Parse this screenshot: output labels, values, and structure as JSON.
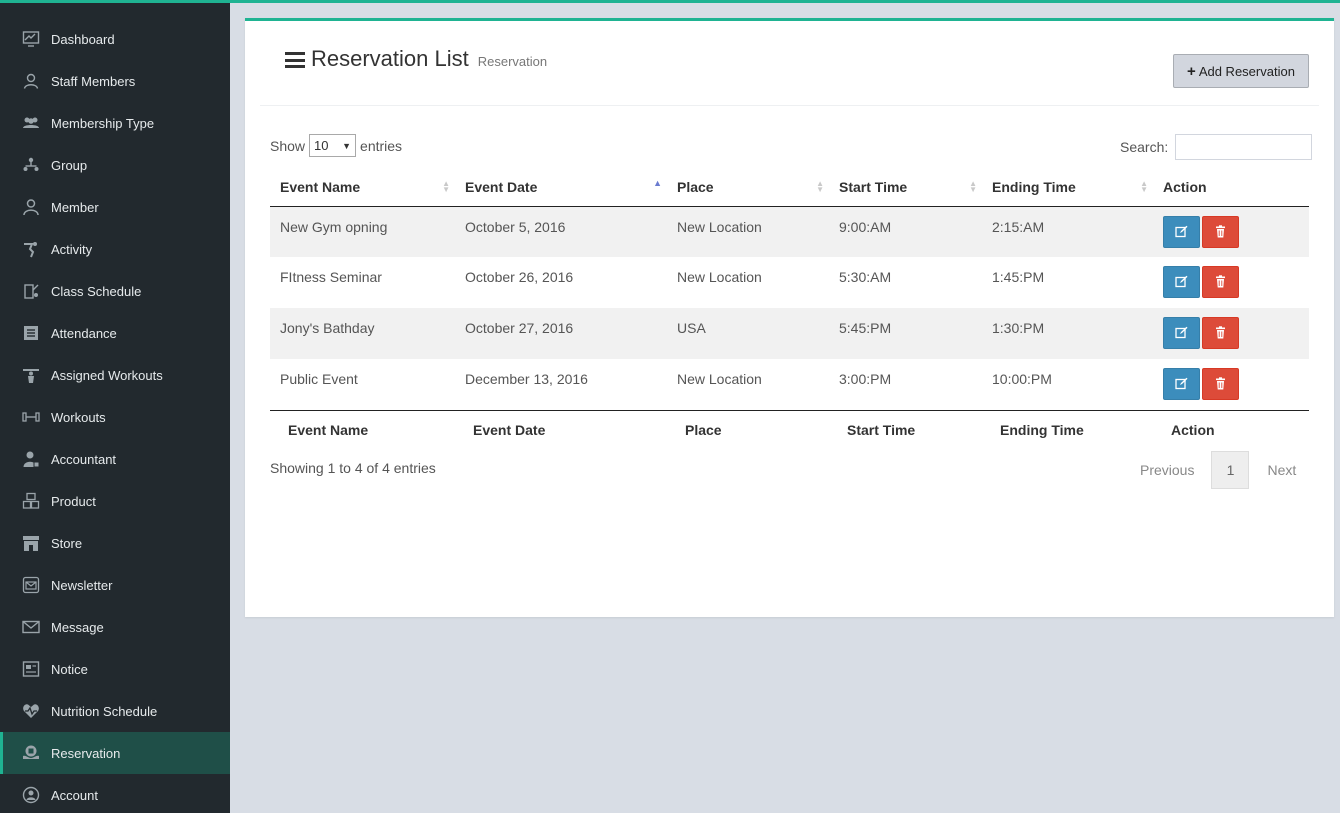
{
  "sidebar": {
    "items": [
      {
        "label": "Dashboard",
        "icon": "dashboard-icon"
      },
      {
        "label": "Staff Members",
        "icon": "staff-icon"
      },
      {
        "label": "Membership Type",
        "icon": "membership-icon"
      },
      {
        "label": "Group",
        "icon": "group-icon"
      },
      {
        "label": "Member",
        "icon": "member-icon"
      },
      {
        "label": "Activity",
        "icon": "activity-icon"
      },
      {
        "label": "Class Schedule",
        "icon": "class-schedule-icon"
      },
      {
        "label": "Attendance",
        "icon": "attendance-icon"
      },
      {
        "label": "Assigned Workouts",
        "icon": "assigned-workouts-icon"
      },
      {
        "label": "Workouts",
        "icon": "workouts-icon"
      },
      {
        "label": "Accountant",
        "icon": "accountant-icon"
      },
      {
        "label": "Product",
        "icon": "product-icon"
      },
      {
        "label": "Store",
        "icon": "store-icon"
      },
      {
        "label": "Newsletter",
        "icon": "newsletter-icon"
      },
      {
        "label": "Message",
        "icon": "message-icon"
      },
      {
        "label": "Notice",
        "icon": "notice-icon"
      },
      {
        "label": "Nutrition Schedule",
        "icon": "nutrition-icon"
      },
      {
        "label": "Reservation",
        "icon": "reservation-icon",
        "active": true
      },
      {
        "label": "Account",
        "icon": "account-icon"
      }
    ]
  },
  "header": {
    "title": "Reservation List",
    "subtitle": "Reservation",
    "add_button": "Add Reservation"
  },
  "controls": {
    "show_label": "Show",
    "entries_value": "10",
    "entries_label": "entries",
    "search_label": "Search:",
    "search_value": ""
  },
  "table": {
    "columns": [
      "Event Name",
      "Event Date",
      "Place",
      "Start Time",
      "Ending Time",
      "Action"
    ],
    "rows": [
      {
        "event_name": "New Gym opning",
        "event_date": "October 5, 2016",
        "place": "New Location",
        "start_time": "9:00:AM",
        "ending_time": "2:15:AM"
      },
      {
        "event_name": "FItness Seminar",
        "event_date": "October 26, 2016",
        "place": "New Location",
        "start_time": "5:30:AM",
        "ending_time": "1:45:PM"
      },
      {
        "event_name": "Jony's Bathday",
        "event_date": "October 27, 2016",
        "place": "USA",
        "start_time": "5:45:PM",
        "ending_time": "1:30:PM"
      },
      {
        "event_name": "Public Event",
        "event_date": "December 13, 2016",
        "place": "New Location",
        "start_time": "3:00:PM",
        "ending_time": "10:00:PM"
      }
    ]
  },
  "footer": {
    "info": "Showing 1 to 4 of 4 entries",
    "previous": "Previous",
    "page": "1",
    "next": "Next"
  },
  "colors": {
    "accent": "#1fb392",
    "sidebar_bg": "#22292e",
    "active_bg": "#1f4f48",
    "edit_button": "#3c8dbc",
    "delete_button": "#dd4b39"
  }
}
